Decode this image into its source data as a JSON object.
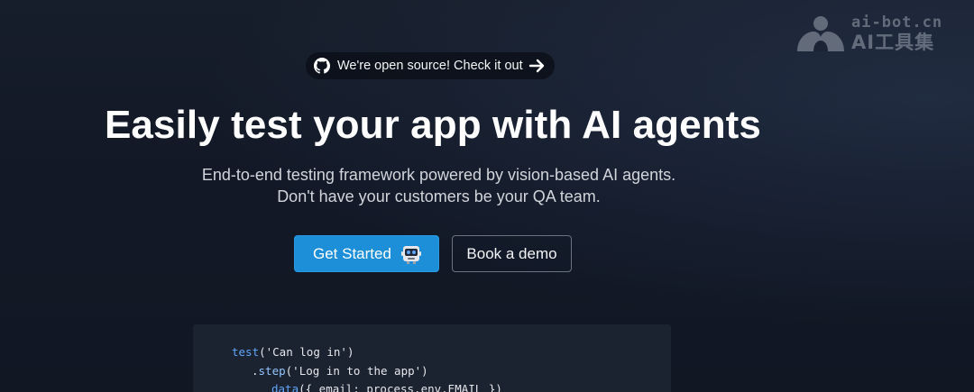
{
  "watermark": {
    "domain": "ai-bot.cn",
    "name": "AI工具集"
  },
  "banner": {
    "text": "We're open source! Check it out",
    "icons": [
      "github-icon",
      "arrow-right-icon"
    ]
  },
  "hero": {
    "headline": "Easily test your app with AI agents",
    "subtitle_line1": "End-to-end testing framework powered by vision-based AI agents.",
    "subtitle_line2": "Don't have your customers be your QA team."
  },
  "actions": {
    "primary_label": "Get Started",
    "secondary_label": "Book a demo",
    "primary_icon": "robot-icon"
  },
  "code": {
    "line1_fn": "test",
    "line1_rest": "('Can log in')",
    "line2_dot": ".",
    "line2_fn": "step",
    "line2_rest": "('Log in to the app')",
    "line3_fn": "data",
    "line3_rest": "({ email: process.env.EMAIL })"
  },
  "colors": {
    "background": "#111827",
    "primary_button": "#1d8fd8",
    "code_background": "#1b2331",
    "keyword": "#60a5fa"
  }
}
